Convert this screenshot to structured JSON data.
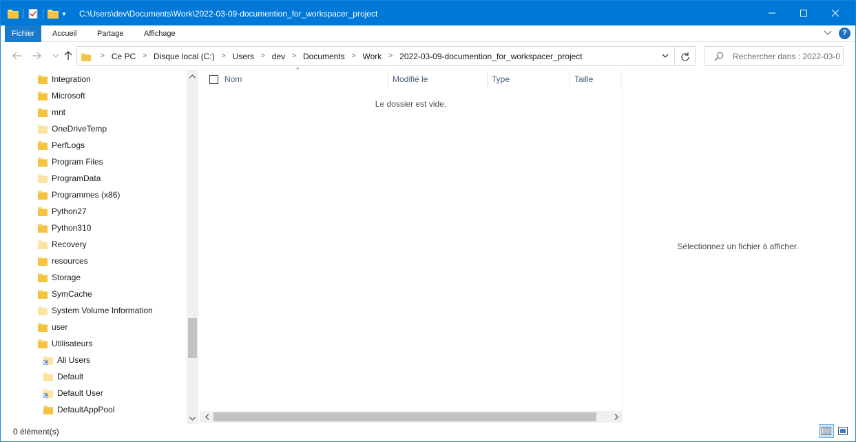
{
  "window": {
    "title": "C:\\Users\\dev\\Documents\\Work\\2022-03-09-documention_for_workspacer_project",
    "accent": "#0078d7"
  },
  "ribbon": {
    "tabs": [
      "Fichier",
      "Accueil",
      "Partage",
      "Affichage"
    ],
    "help_label": "?"
  },
  "address": {
    "breadcrumbs": [
      "Ce PC",
      "Disque local (C:)",
      "Users",
      "dev",
      "Documents",
      "Work",
      "2022-03-09-documention_for_workspacer_project"
    ]
  },
  "search": {
    "placeholder": "Rechercher dans : 2022-03-0..."
  },
  "nav": {
    "items": [
      {
        "label": "Integration",
        "icon": "folder-icon"
      },
      {
        "label": "Microsoft",
        "icon": "folder-icon"
      },
      {
        "label": "mnt",
        "icon": "folder-icon"
      },
      {
        "label": "OneDriveTemp",
        "icon": "folder-light-icon"
      },
      {
        "label": "PerfLogs",
        "icon": "folder-icon"
      },
      {
        "label": "Program Files",
        "icon": "folder-icon"
      },
      {
        "label": "ProgramData",
        "icon": "folder-light-icon"
      },
      {
        "label": "Programmes (x86)",
        "icon": "folder-icon"
      },
      {
        "label": "Python27",
        "icon": "folder-icon"
      },
      {
        "label": "Python310",
        "icon": "folder-icon"
      },
      {
        "label": "Recovery",
        "icon": "folder-light-icon"
      },
      {
        "label": "resources",
        "icon": "folder-icon"
      },
      {
        "label": "Storage",
        "icon": "folder-icon"
      },
      {
        "label": "SymCache",
        "icon": "folder-icon"
      },
      {
        "label": "System Volume Information",
        "icon": "folder-light-icon"
      },
      {
        "label": "user",
        "icon": "folder-icon"
      },
      {
        "label": "Utilisateurs",
        "icon": "folder-icon"
      },
      {
        "label": "All Users",
        "icon": "shortcut-folder-icon"
      },
      {
        "label": "Default",
        "icon": "folder-light-icon"
      },
      {
        "label": "Default User",
        "icon": "shortcut-folder-icon"
      },
      {
        "label": "DefaultAppPool",
        "icon": "folder-icon"
      }
    ]
  },
  "filelist": {
    "columns": [
      "Nom",
      "Modifié le",
      "Type",
      "Taille"
    ],
    "empty_message": "Le dossier est vide."
  },
  "preview": {
    "message": "Sélectionnez un fichier à afficher."
  },
  "status": {
    "item_count": "0 élément(s)"
  }
}
